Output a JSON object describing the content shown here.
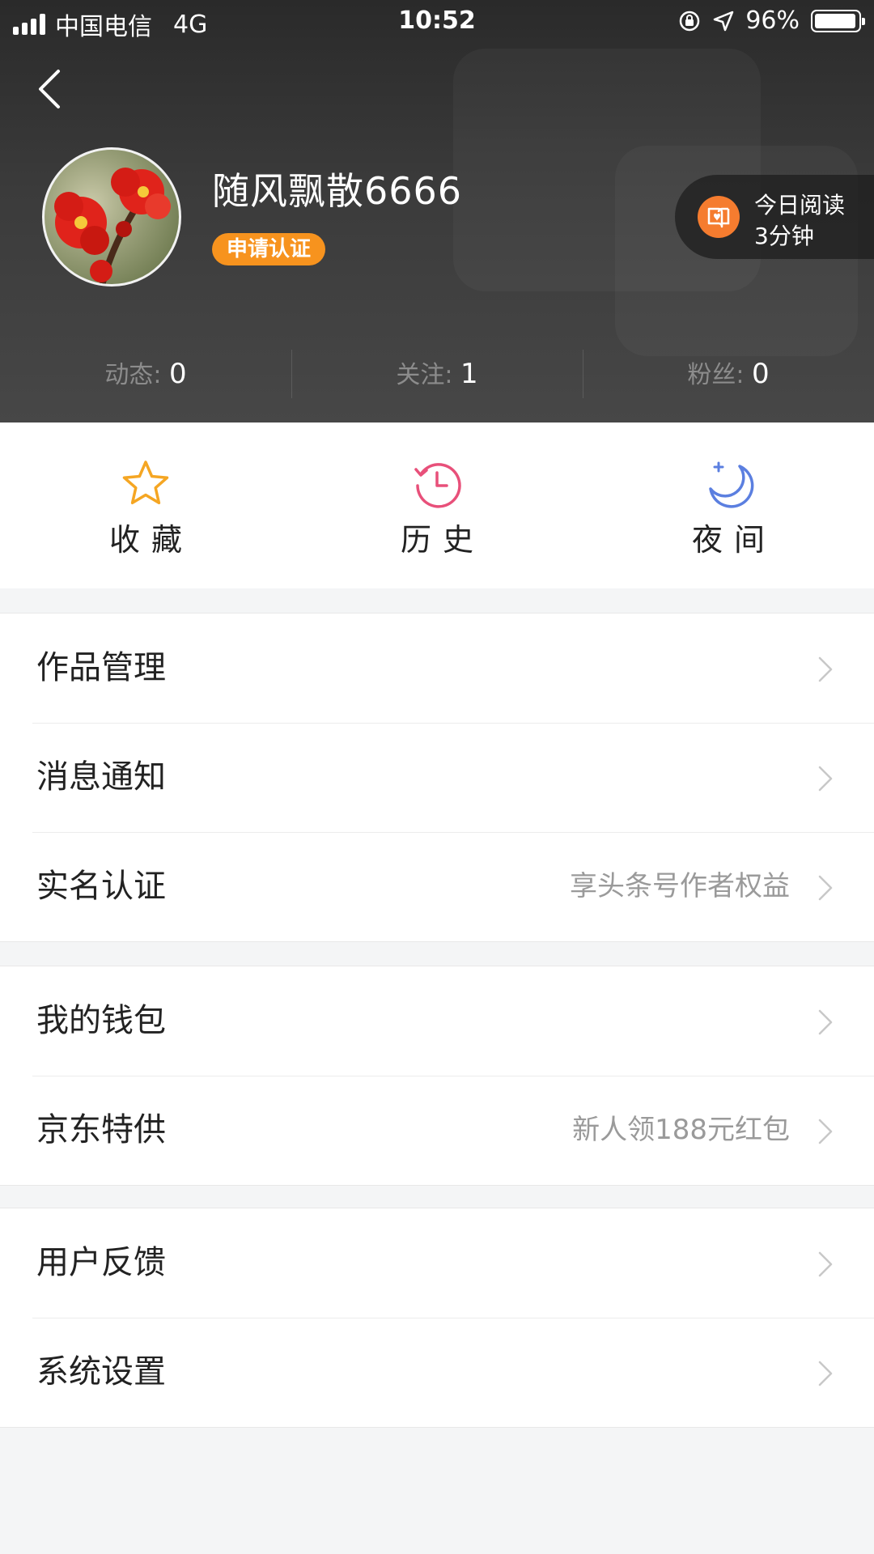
{
  "statusbar": {
    "carrier": "中国电信",
    "network": "4G",
    "time": "10:52",
    "battery": "96%",
    "battery_level": 0.96
  },
  "profile": {
    "username": "随风飘散6666",
    "verify_badge": "申请认证",
    "reading_line1": "今日阅读",
    "reading_line2": "3分钟"
  },
  "stats": [
    {
      "label": "动态:",
      "value": "0"
    },
    {
      "label": "关注:",
      "value": "1"
    },
    {
      "label": "粉丝:",
      "value": "0"
    }
  ],
  "quick_actions": [
    {
      "label": "收藏",
      "icon": "star-icon",
      "color": "#f5a623"
    },
    {
      "label": "历史",
      "icon": "history-clock-icon",
      "color": "#e8507a"
    },
    {
      "label": "夜间",
      "icon": "moon-icon",
      "color": "#5b7fe0"
    }
  ],
  "menu_groups": [
    [
      {
        "label": "作品管理",
        "hint": ""
      },
      {
        "label": "消息通知",
        "hint": ""
      },
      {
        "label": "实名认证",
        "hint": "享头条号作者权益"
      }
    ],
    [
      {
        "label": "我的钱包",
        "hint": ""
      },
      {
        "label": "京东特供",
        "hint": "新人领188元红包"
      }
    ],
    [
      {
        "label": "用户反馈",
        "hint": ""
      },
      {
        "label": "系统设置",
        "hint": ""
      }
    ]
  ],
  "colors": {
    "accent_orange": "#f7931e",
    "header_bg": "#3b3b3b",
    "page_bg": "#f4f5f6"
  }
}
